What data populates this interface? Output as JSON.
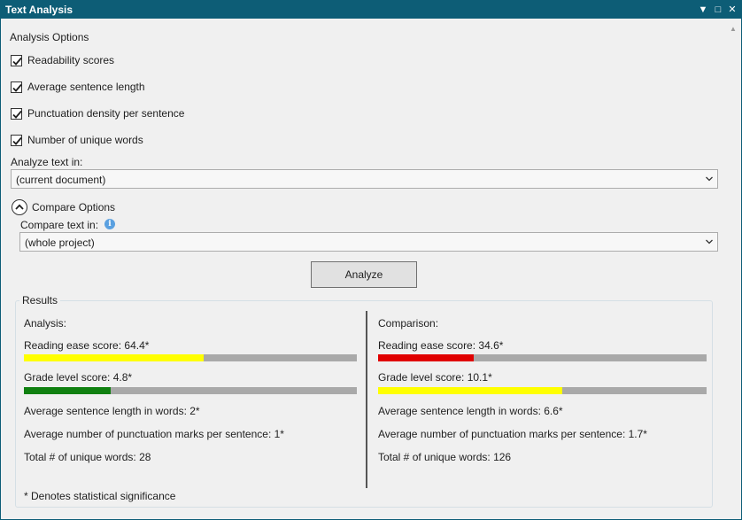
{
  "window": {
    "title": "Text Analysis",
    "controls": {
      "dropdown": "▼",
      "maximize": "□",
      "close": "✕"
    }
  },
  "analysis_options": {
    "heading": "Analysis Options",
    "checkboxes": [
      {
        "label": "Readability scores",
        "checked": true
      },
      {
        "label": "Average sentence length",
        "checked": true
      },
      {
        "label": "Punctuation density per sentence",
        "checked": true
      },
      {
        "label": "Number of unique words",
        "checked": true
      }
    ],
    "analyze_in_label": "Analyze text in:",
    "analyze_in_value": "(current document)"
  },
  "compare_options": {
    "heading": "Compare Options",
    "expanded": true,
    "compare_in_label": "Compare text in:",
    "compare_in_value": "(whole project)"
  },
  "analyze_button": "Analyze",
  "results": {
    "legend": "Results",
    "footnote": "* Denotes statistical significance",
    "analysis": {
      "heading": "Analysis:",
      "reading_ease": "Reading ease score: 64.4*",
      "reading_ease_fraction": 0.54,
      "reading_ease_color": "#ffff00",
      "grade_level": "Grade level score: 4.8*",
      "grade_level_fraction": 0.26,
      "grade_level_color": "#108010",
      "avg_sentence_length": "Average sentence length in words: 2*",
      "avg_punctuation": "Average number of punctuation marks per sentence: 1*",
      "unique_words": "Total # of unique words: 28"
    },
    "comparison": {
      "heading": "Comparison:",
      "reading_ease": "Reading ease score: 34.6*",
      "reading_ease_fraction": 0.29,
      "reading_ease_color": "#e00000",
      "grade_level": "Grade level score: 10.1*",
      "grade_level_fraction": 0.56,
      "grade_level_color": "#ffff00",
      "avg_sentence_length": "Average sentence length in words: 6.6*",
      "avg_punctuation": "Average number of punctuation marks per sentence: 1.7*",
      "unique_words": "Total # of unique words: 126"
    }
  },
  "colors": {
    "titlebar": "#0d5d76",
    "bar_track": "#a9a9a9",
    "info_icon": "#5aa0e0"
  }
}
